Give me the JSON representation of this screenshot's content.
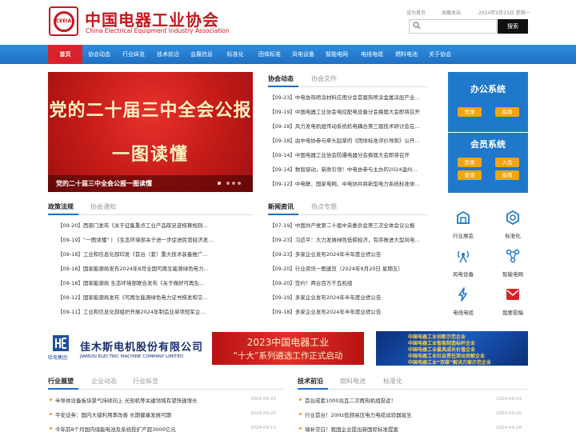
{
  "header": {
    "logo_cn": "中国电器工业协会",
    "logo_en": "China Electrical Equipment Industry Association",
    "logo_mark_text": "CEEIA",
    "top_links": [
      "设为首页",
      "收藏本站",
      "2024年9月23日 星期一"
    ],
    "search_placeholder": "",
    "search_button": "搜索"
  },
  "nav": [
    "首页",
    "协会动态",
    "行业纵览",
    "技术前沿",
    "会展信息",
    "标准化",
    "团体标准",
    "风电设备",
    "智能电网",
    "电线电缆",
    "燃料电池",
    "关于协会"
  ],
  "banner": {
    "line1": "党的二十届三中全会公报",
    "line2": "一图读懂",
    "caption": "党的二十届三中全会公报一图读懂"
  },
  "assoc_news": {
    "tabs": [
      "协会动态",
      "协会文件"
    ],
    "items": [
      "【09-23】中电协热喷涂材料应用分会首届热喷涂金属涂层产业...",
      "【09-19】中国电器工业协会电控配电设备分会换届大会即将召开",
      "【09-18】风力发电机组传动系统机电耦合第三届技术研讨会在...",
      "【09-18】由中电协参与牵头起草的《团体标准评价导则》公开...",
      "【09-14】中国电器工业协会防爆电器分会换届大会即将召开",
      "【09-14】数智驱动，新质引领！中电协参与主办的2024温州...",
      "【09-12】中电联、国家电网、中电协共商新型电力系统标准体..."
    ]
  },
  "policy": {
    "tabs": [
      "政策法规",
      "协会通知"
    ],
    "items": [
      "【09-20】西部门发布《关于征集重点工业产品碳足迹核算规则...",
      "【09-19】“一图读懂”丨《生态环境部关于进一步促进民营经济发展...",
      "【09-18】工业和信息化部印发《首台（套）重大技术装备推广...",
      "【09-18】国家能源局发布2024年8月全国可再生能源绿色电力...",
      "【09-18】国家能源局 生态环境部联合发布《关于做好可再生...",
      "【09-12】国家能源局发布《可再生能源绿色电力证书核发和交...",
      "【09-11】工业和信息化部组织开展2024年制造业单项冠军企..."
    ]
  },
  "news": {
    "tabs": [
      "新闻资讯",
      "热点专题"
    ],
    "items": [
      "【07-19】中国共产党第二十届中央委员会第三次全体会议公报",
      "【09-23】习近平：大力发展绿色低碳经济，有序推进大型风电...",
      "【09-23】多家企业发布2024年半年度业绩公告",
      "【09-20】行业资讯一图速览（2024年9月20日 星期五）",
      "【09-20】签约！两台百万千瓦机组",
      "【09-19】多家企业发布2024年半年度业绩公告",
      "【09-18】多家企业发布2024年半年度业绩公告"
    ]
  },
  "side": {
    "office_title": "办公系统",
    "office_buttons": [
      "登录",
      "指南"
    ],
    "member_title": "会员系统",
    "member_buttons": [
      "登录",
      "入会",
      "查询",
      "指南"
    ]
  },
  "services": [
    "行业展会",
    "标准化",
    "风电设备",
    "智能电网",
    "电线电缆",
    "我要投稿"
  ],
  "ads": {
    "company_logo_text": "哈电集团",
    "company_cn": "佳木斯电机股份有限公司",
    "company_en": "JIAMUSI ELECTRIC MACHINE COMPANY LIMITED",
    "red_line1": "2023中国电器工业",
    "red_line2": "“十大”系列遴选工作正式启动",
    "blue_lines": [
      "中国电器工业创新示范企业",
      "中国电器工业智能制造标杆企业",
      "中国电器工业最具成长价值企业",
      "中国电器工业社会责任突出贡献企业",
      "中国电器工业“双碳”解决方案示范企业"
    ]
  },
  "bottom_left": {
    "tabs": [
      "行业展望",
      "企业动态",
      "行业纵览"
    ],
    "items": [
      {
        "text": "半导体设备板块景气持续向上 光刻机等关键领域有望快速增长",
        "date": "2024-09-23"
      },
      {
        "text": "平安证券：国内大储利用率改善 长期健康发展可期",
        "date": "2024-09-20"
      },
      {
        "text": "今年前8个月国内储能电池及系统投扩产超3000亿元",
        "date": "2024-09-13"
      }
    ]
  },
  "bottom_right": {
    "tabs": [
      "技术前沿",
      "燃料电池",
      "标准化"
    ],
    "items": [
      {
        "text": "首台成套1000兆瓦二次再热机组投运！",
        "date": "2024-09-23"
      },
      {
        "text": "行业首台！20Hz低频高压电力电缆试验器诞生",
        "date": "2024-09-20"
      },
      {
        "text": "填补空白！我国企业提出新国际标准提案",
        "date": "2024-09-18"
      }
    ]
  },
  "colors": {
    "red": "#c8161d",
    "blue": "#1f6fc2",
    "orange": "#f2a60c"
  }
}
